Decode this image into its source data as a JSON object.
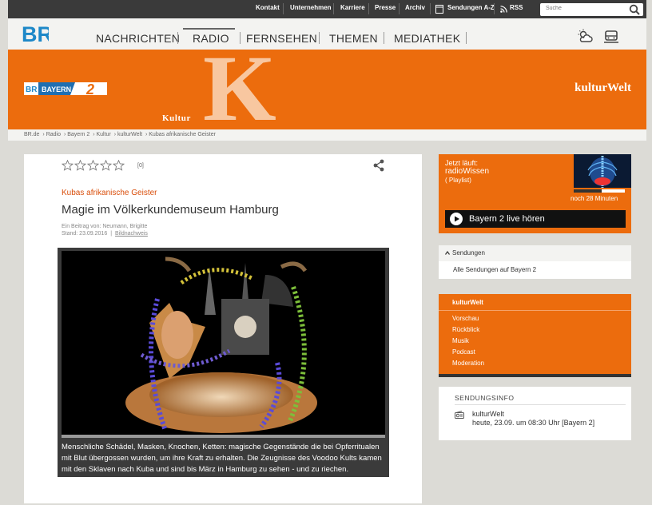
{
  "topbar": {
    "links": [
      "Kontakt",
      "Unternehmen",
      "Karriere",
      "Presse",
      "Archiv",
      "Sendungen A-Z",
      "RSS"
    ],
    "search_placeholder": "Suche"
  },
  "brand": {
    "logo_text": "BR"
  },
  "nav": {
    "items": [
      "NACHRICHTEN",
      "RADIO",
      "FERNSEHEN",
      "THEMEN",
      "MEDIATHEK"
    ],
    "active": "RADIO"
  },
  "banner": {
    "station_logo": "BAYERN 2",
    "big_letter": "K",
    "label": "Kultur",
    "title": "kulturWelt"
  },
  "breadcrumb": [
    "BR.de",
    "Radio",
    "Bayern 2",
    "Kultur",
    "kulturWelt",
    "Kubas afrikanische Geister"
  ],
  "article": {
    "rating_count": "[0]",
    "kicker": "Kubas afrikanische Geister",
    "headline": "Magie im Völkerkundemuseum Hamburg",
    "author": "Ein Beitrag von: Neumann, Brigitte",
    "date": "Stand: 23.09.2016",
    "credits_link": "Bildnachweis",
    "caption": "Menschliche Schädel, Masken, Knochen, Ketten: magische Gegenstände die bei Opferritualen mit Blut übergossen wurden, um ihre Kraft zu erhalten. Die Zeugnisse des Voodoo Kults kamen mit den Sklaven nach Kuba und sind bis März in Hamburg zu sehen - und zu riechen."
  },
  "now_playing": {
    "label": "Jetzt läuft:",
    "show": "radioWissen",
    "playlist": "( Playlist)",
    "remaining": "noch 28 Minuten",
    "progress": 0.55,
    "live_button": "Bayern 2 live hören"
  },
  "sendungen": {
    "title": "Sendungen",
    "link": "Alle Sendungen auf Bayern 2"
  },
  "kulturwelt_box": {
    "title": "kulturWelt",
    "links": [
      "Vorschau",
      "Rückblick",
      "Musik",
      "Podcast",
      "Moderation"
    ]
  },
  "sendungsinfo": {
    "title": "SENDUNGSINFO",
    "show": "kulturWelt",
    "when": "heute, 23.09. um 08:30 Uhr [Bayern 2]"
  },
  "colors": {
    "accent_orange": "#ec6c0d",
    "kicker_orange": "#d94e0b",
    "topbar": "#3a3a3a",
    "background": "#dcdbd6"
  }
}
